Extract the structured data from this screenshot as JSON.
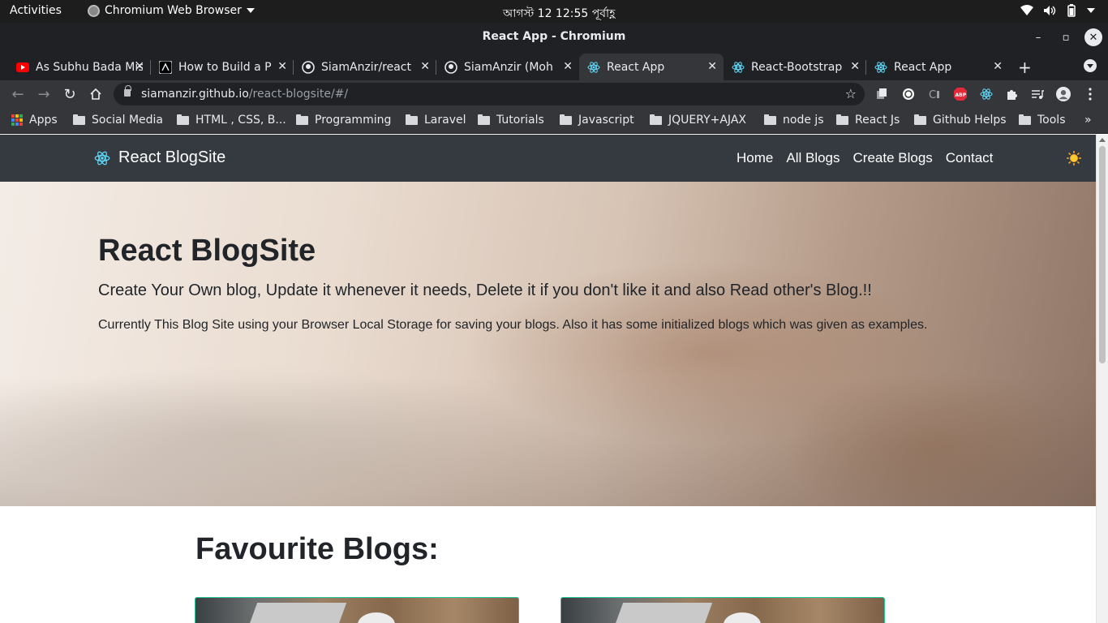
{
  "system": {
    "activities": "Activities",
    "app_menu": "Chromium Web Browser",
    "clock": "আগস্ট 12  12:55 পূর্বাহ্ণ"
  },
  "window": {
    "title": "React App - Chromium"
  },
  "tabs": [
    {
      "label": "As Subhu Bada Mishra",
      "icon": "youtube-icon",
      "active": false
    },
    {
      "label": "How to Build a P",
      "icon": "dev-icon",
      "active": false
    },
    {
      "label": "SiamAnzir/react",
      "icon": "github-icon",
      "active": false
    },
    {
      "label": "SiamAnzir (Moh",
      "icon": "github-icon",
      "active": false
    },
    {
      "label": "React App",
      "icon": "react-icon",
      "active": true
    },
    {
      "label": "React-Bootstrap",
      "icon": "react-bootstrap-icon",
      "active": false
    },
    {
      "label": "React App",
      "icon": "react-icon",
      "active": false
    }
  ],
  "omnibox": {
    "host": "siamanzir.github.io",
    "path": "/react-blogsite/#/"
  },
  "bookmarks": [
    {
      "label": "Apps"
    },
    {
      "label": "Social Media"
    },
    {
      "label": "HTML , CSS, B..."
    },
    {
      "label": "Programming"
    },
    {
      "label": "Laravel"
    },
    {
      "label": "Tutorials"
    },
    {
      "label": "Javascript"
    },
    {
      "label": "JQUERY+AJAX"
    },
    {
      "label": "node js"
    },
    {
      "label": "React Js"
    },
    {
      "label": "Github Helps"
    },
    {
      "label": "Tools"
    }
  ],
  "bookmarks_overflow": "»",
  "site": {
    "brand": "React BlogSite",
    "nav": [
      "Home",
      "All Blogs",
      "Create Blogs",
      "Contact"
    ],
    "theme_toggle_icon": "sun-icon"
  },
  "hero": {
    "title": "React BlogSite",
    "lead": "Create Your Own blog, Update it whenever it needs, Delete it if you don't like it and also Read other's Blog.!!",
    "description": "Currently This Blog Site using your Browser Local Storage for saving your blogs. Also it has some initialized blogs which was given as examples."
  },
  "favourites": {
    "heading": "Favourite Blogs:"
  },
  "colors": {
    "navbar": "#343a40",
    "card_border": "#20c997",
    "react": "#61dafb"
  }
}
